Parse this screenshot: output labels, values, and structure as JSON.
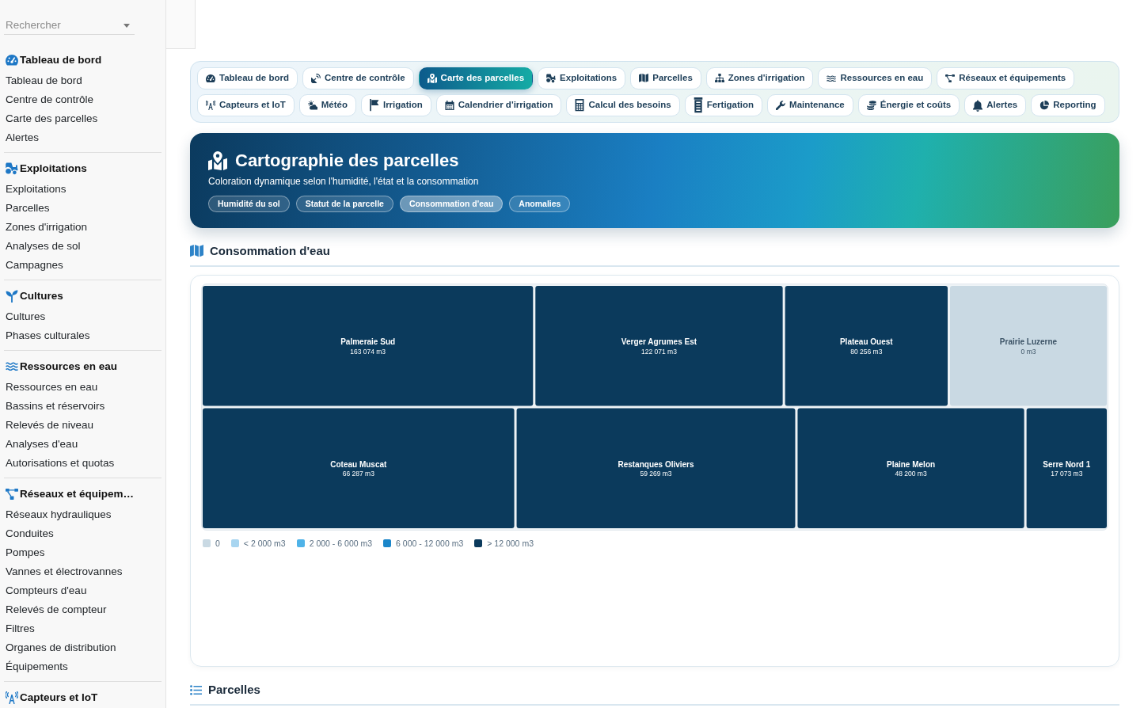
{
  "sidebar": {
    "search": {
      "placeholder": "Rechercher"
    },
    "groups": [
      {
        "title": "Tableau de bord",
        "items": [
          "Tableau de bord",
          "Centre de contrôle",
          "Carte des parcelles",
          "Alertes"
        ]
      },
      {
        "title": "Exploitations",
        "items": [
          "Exploitations",
          "Parcelles",
          "Zones d'irrigation",
          "Analyses de sol",
          "Campagnes"
        ]
      },
      {
        "title": "Cultures",
        "items": [
          "Cultures",
          "Phases culturales"
        ]
      },
      {
        "title": "Ressources en eau",
        "items": [
          "Ressources en eau",
          "Bassins et réservoirs",
          "Relevés de niveau",
          "Analyses d'eau",
          "Autorisations et quotas"
        ]
      },
      {
        "title": "Réseaux et équipem…",
        "items": [
          "Réseaux hydrauliques",
          "Conduites",
          "Pompes",
          "Vannes et électrovannes",
          "Compteurs d'eau",
          "Relevés de compteur",
          "Filtres",
          "Organes de distribution",
          "Équipements"
        ]
      },
      {
        "title": "Capteurs et IoT"
      }
    ]
  },
  "nav_tabs": [
    {
      "label": "Tableau de bord",
      "selected": false
    },
    {
      "label": "Centre de contrôle",
      "selected": false
    },
    {
      "label": "Carte des parcelles",
      "selected": true
    },
    {
      "label": "Exploitations",
      "selected": false
    },
    {
      "label": "Parcelles",
      "selected": false
    },
    {
      "label": "Zones d'irrigation",
      "selected": false
    },
    {
      "label": "Ressources en eau",
      "selected": false
    },
    {
      "label": "Réseaux et équipements",
      "selected": false
    },
    {
      "label": "Capteurs et IoT",
      "selected": false
    },
    {
      "label": "Météo",
      "selected": false
    },
    {
      "label": "Irrigation",
      "selected": false
    },
    {
      "label": "Calendrier d'irrigation",
      "selected": false
    },
    {
      "label": "Calcul des besoins",
      "selected": false
    },
    {
      "label": "Fertigation",
      "selected": false
    },
    {
      "label": "Maintenance",
      "selected": false
    },
    {
      "label": "Énergie et coûts",
      "selected": false
    },
    {
      "label": "Alertes",
      "selected": false
    },
    {
      "label": "Reporting",
      "selected": false
    }
  ],
  "banner": {
    "title": "Cartographie des parcelles",
    "subtitle": "Coloration dynamique selon l'humidité, l'état et la consommation",
    "layers": [
      {
        "label": "Humidité du sol",
        "selected": false
      },
      {
        "label": "Statut de la parcelle",
        "selected": false
      },
      {
        "label": "Consommation d'eau",
        "selected": true
      },
      {
        "label": "Anomalies",
        "selected": false
      }
    ]
  },
  "map_section": {
    "title": "Consommation d'eau",
    "chart_data": {
      "type": "other",
      "categories": [
        "Palmeraie Sud",
        "Verger Agrumes Est",
        "Plateau Ouest",
        "Prairie Luzerne",
        "Coteau Muscat",
        "Restanques Oliviers",
        "Plaine Melon",
        "Serre Nord 1"
      ],
      "values": [
        163074,
        122071,
        80256,
        0,
        66287,
        59269,
        48200,
        17073
      ],
      "value_labels": [
        "163 074 m3",
        "122 071 m3",
        "80 256 m3",
        "0 m3",
        "66 287 m3",
        "59 269 m3",
        "48 200 m3",
        "17 073 m3"
      ],
      "colors": [
        "#0b3a5c",
        "#0b3a5c",
        "#0b3a5c",
        "#c9d9e3",
        "#0b3a5c",
        "#0b3a5c",
        "#0b3a5c",
        "#0b3a5c"
      ]
    },
    "legend": [
      {
        "label": "0",
        "color": "#c9d9e3"
      },
      {
        "label": "< 2 000 m3",
        "color": "#a8d5f0"
      },
      {
        "label": "2 000 - 6 000 m3",
        "color": "#4fb3e8"
      },
      {
        "label": "6 000 - 12 000 m3",
        "color": "#1b86c9"
      },
      {
        "label": "> 12 000 m3",
        "color": "#0b3a5c"
      }
    ]
  },
  "next_section": {
    "title": "Parcelles"
  }
}
